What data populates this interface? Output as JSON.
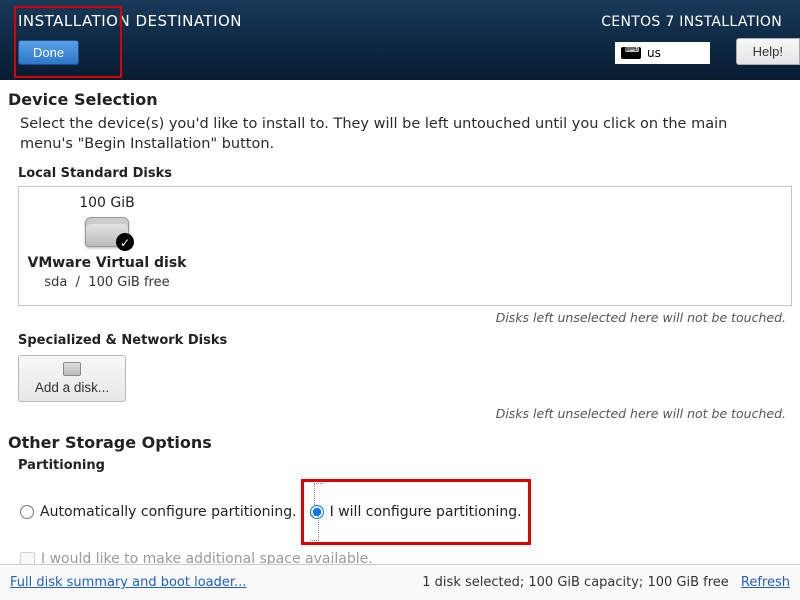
{
  "header": {
    "title": "INSTALLATION DESTINATION",
    "subtitle": "CENTOS 7 INSTALLATION",
    "done_label": "Done",
    "help_label": "Help!",
    "keyboard_layout": "us"
  },
  "device_selection": {
    "title": "Device Selection",
    "description": "Select the device(s) you'd like to install to.  They will be left untouched until you click on the main menu's \"Begin Installation\" button."
  },
  "local_disks": {
    "heading": "Local Standard Disks",
    "disk": {
      "size": "100 GiB",
      "name": "VMware Virtual disk",
      "dev": "sda",
      "free": "100 GiB free",
      "selected": true
    },
    "hint": "Disks left unselected here will not be touched."
  },
  "special_disks": {
    "heading": "Specialized & Network Disks",
    "add_label": "Add a disk...",
    "hint": "Disks left unselected here will not be touched."
  },
  "storage": {
    "title": "Other Storage Options",
    "partitioning_heading": "Partitioning",
    "auto_label": "Automatically configure partitioning.",
    "manual_label": "I will configure partitioning.",
    "manual_selected": true,
    "extra_space_label": "I would like to make additional space available."
  },
  "footer": {
    "summary_link": "Full disk summary and boot loader...",
    "status": "1 disk selected; 100 GiB capacity; 100 GiB free",
    "refresh_label": "Refresh"
  }
}
